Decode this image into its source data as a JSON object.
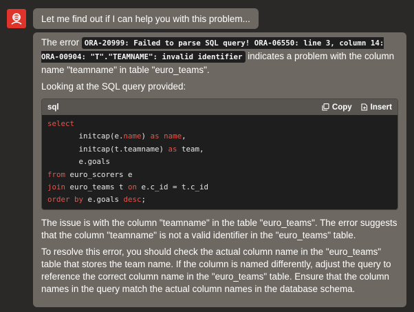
{
  "greeting": "Let me find out if I can help you with this problem...",
  "message": {
    "intro_before": "The error ",
    "error_code": "ORA-20999: Failed to parse SQL query! ORA-06550: line 3, column 14: ORA-00904: \"T\".\"TEAMNAME\": invalid identifier",
    "intro_after": " indicates a problem with the column name \"teamname\" in table \"euro_teams\".",
    "looking": "Looking at the SQL query provided:",
    "issue": "The issue is with the column \"teamname\" in the table \"euro_teams\". The error suggests that the column \"teamname\" is not a valid identifier in the \"euro_teams\" table.",
    "resolve": "To resolve this error, you should check the actual column name in the \"euro_teams\" table that stores the team name. If the column is named differently, adjust the query to reference the correct column name in the \"euro_teams\" table. Ensure that the column names in the query match the actual column names in the database schema."
  },
  "code": {
    "language": "sql",
    "copy_label": "Copy",
    "insert_label": "Insert",
    "lines": [
      {
        "text": "select",
        "kw": [
          "select"
        ]
      },
      {
        "text": "       initcap(e.name) as name,",
        "kw": [
          "name",
          "as",
          "name"
        ]
      },
      {
        "text": "       initcap(t.teamname) as team,",
        "kw": [
          "as"
        ]
      },
      {
        "text": "       e.goals",
        "kw": []
      },
      {
        "text": "from euro_scorers e",
        "kw": [
          "from"
        ]
      },
      {
        "text": "join euro_teams t on e.c_id = t.c_id",
        "kw": [
          "join",
          "on"
        ]
      },
      {
        "text": "order by e.goals desc;",
        "kw": [
          "order by",
          "desc"
        ]
      }
    ]
  },
  "colors": {
    "avatar_bg": "#e0332a",
    "bubble_bg": "#6d6862",
    "page_bg": "#2b2927",
    "keyword": "#e5554b"
  },
  "icons": [
    "assistant-avatar-icon",
    "copy-icon",
    "insert-icon"
  ]
}
